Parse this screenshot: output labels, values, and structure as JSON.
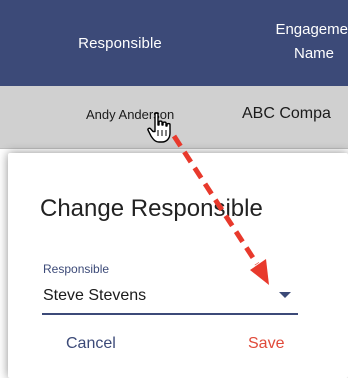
{
  "table": {
    "headers": {
      "responsible": "Responsible",
      "engagement_line1": "Engageme",
      "engagement_line2": "Name"
    },
    "row": {
      "responsible": "Andy Anderson",
      "engagement": "ABC Compa"
    }
  },
  "dialog": {
    "title": "Change Responsible",
    "field": {
      "label": "Responsible",
      "value": "Steve Stevens"
    },
    "buttons": {
      "cancel": "Cancel",
      "save": "Save"
    }
  },
  "colors": {
    "header_bg": "#3c4a78",
    "row_bg": "#d0d0d0",
    "accent": "#3c4a78",
    "save": "#e04a3a",
    "annotation_arrow": "#e8392c"
  },
  "icons": {
    "cursor": "hand-pointer-icon",
    "dropdown": "caret-down-icon",
    "annotation": "dashed-arrow-annotation"
  }
}
